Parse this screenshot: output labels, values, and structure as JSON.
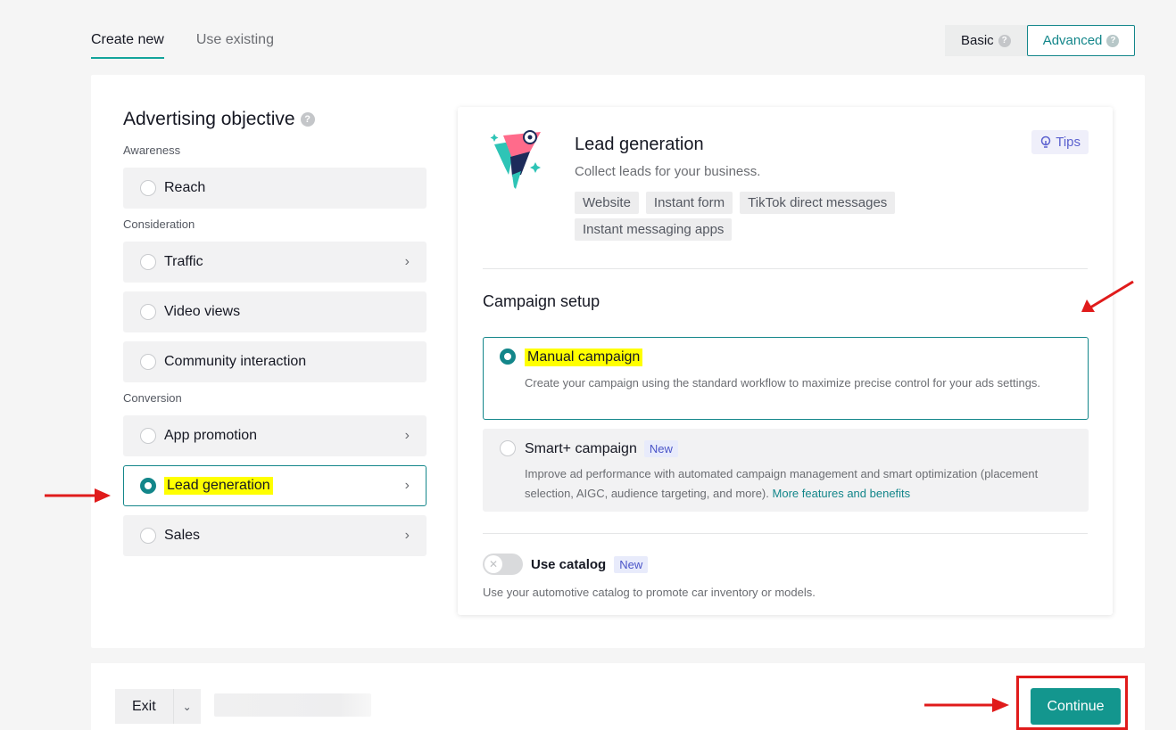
{
  "top_tabs": [
    {
      "label": "Create new",
      "active": true
    },
    {
      "label": "Use existing",
      "active": false
    }
  ],
  "mode_toggle": {
    "basic": "Basic",
    "advanced": "Advanced",
    "selected": "Advanced"
  },
  "objective": {
    "title": "Advertising objective",
    "groups": [
      {
        "label": "Awareness",
        "items": [
          {
            "label": "Reach",
            "selected": false,
            "has_chevron": false
          }
        ]
      },
      {
        "label": "Consideration",
        "items": [
          {
            "label": "Traffic",
            "selected": false,
            "has_chevron": true
          },
          {
            "label": "Video views",
            "selected": false,
            "has_chevron": false
          },
          {
            "label": "Community interaction",
            "selected": false,
            "has_chevron": false
          }
        ]
      },
      {
        "label": "Conversion",
        "items": [
          {
            "label": "App promotion",
            "selected": false,
            "has_chevron": true
          },
          {
            "label": "Lead generation",
            "selected": true,
            "has_chevron": true
          },
          {
            "label": "Sales",
            "selected": false,
            "has_chevron": true
          }
        ]
      }
    ]
  },
  "detail": {
    "title": "Lead generation",
    "subtitle": "Collect leads for your business.",
    "tags": [
      "Website",
      "Instant form",
      "TikTok direct messages",
      "Instant messaging apps"
    ],
    "tips": "Tips"
  },
  "campaign_setup": {
    "title": "Campaign setup",
    "options": [
      {
        "title": "Manual campaign",
        "desc": "Create your campaign using the standard workflow to maximize precise control for your ads settings.",
        "selected": true
      },
      {
        "title": "Smart+ campaign",
        "badge": "New",
        "desc": "Improve ad performance with automated campaign management and smart optimization (placement selection, AIGC, audience targeting, and more).",
        "link": "More features and benefits",
        "selected": false
      }
    ]
  },
  "catalog": {
    "label": "Use catalog",
    "badge": "New",
    "desc": "Use your automotive catalog to promote car inventory or models.",
    "enabled": false
  },
  "footer": {
    "exit": "Exit",
    "continue": "Continue"
  },
  "colors": {
    "accent": "#13868a",
    "continue": "#13968e",
    "annotation": "#e01b1b",
    "highlight": "#ffff00"
  }
}
